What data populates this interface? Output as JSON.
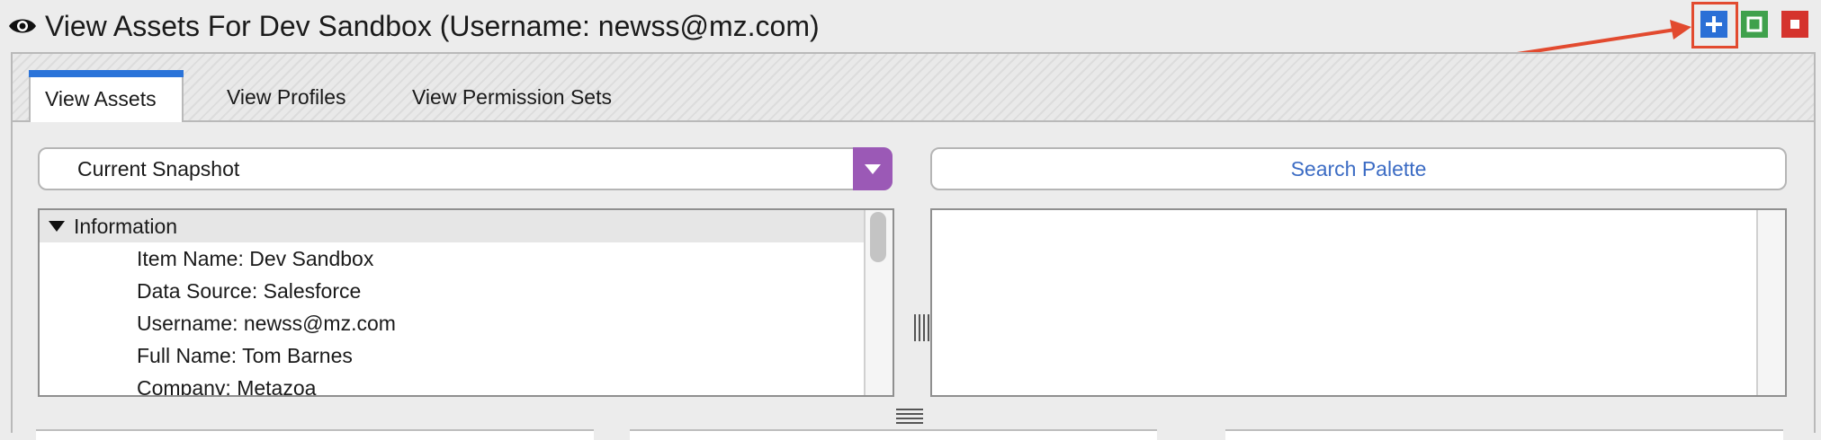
{
  "window": {
    "title": "View Assets For Dev Sandbox (Username: newss@mz.com)",
    "controls": [
      "add",
      "maximize",
      "close"
    ],
    "colors": {
      "add": "#2a6fd6",
      "maximize": "#3fa14c",
      "close": "#d5332d",
      "annotation": "#e24a2f"
    }
  },
  "tabs": [
    {
      "label": "View Assets",
      "active": true
    },
    {
      "label": "View Profiles",
      "active": false
    },
    {
      "label": "View Permission Sets",
      "active": false
    }
  ],
  "snapshot": {
    "selected": "Current Snapshot",
    "accent": "#9b59b6"
  },
  "search_palette": {
    "label": "Search Palette"
  },
  "information": {
    "header": "Information",
    "items": [
      "Item Name: Dev Sandbox",
      "Data Source: Salesforce",
      "Username: newss@mz.com",
      "Full Name: Tom Barnes",
      "Company: Metazoa"
    ]
  }
}
